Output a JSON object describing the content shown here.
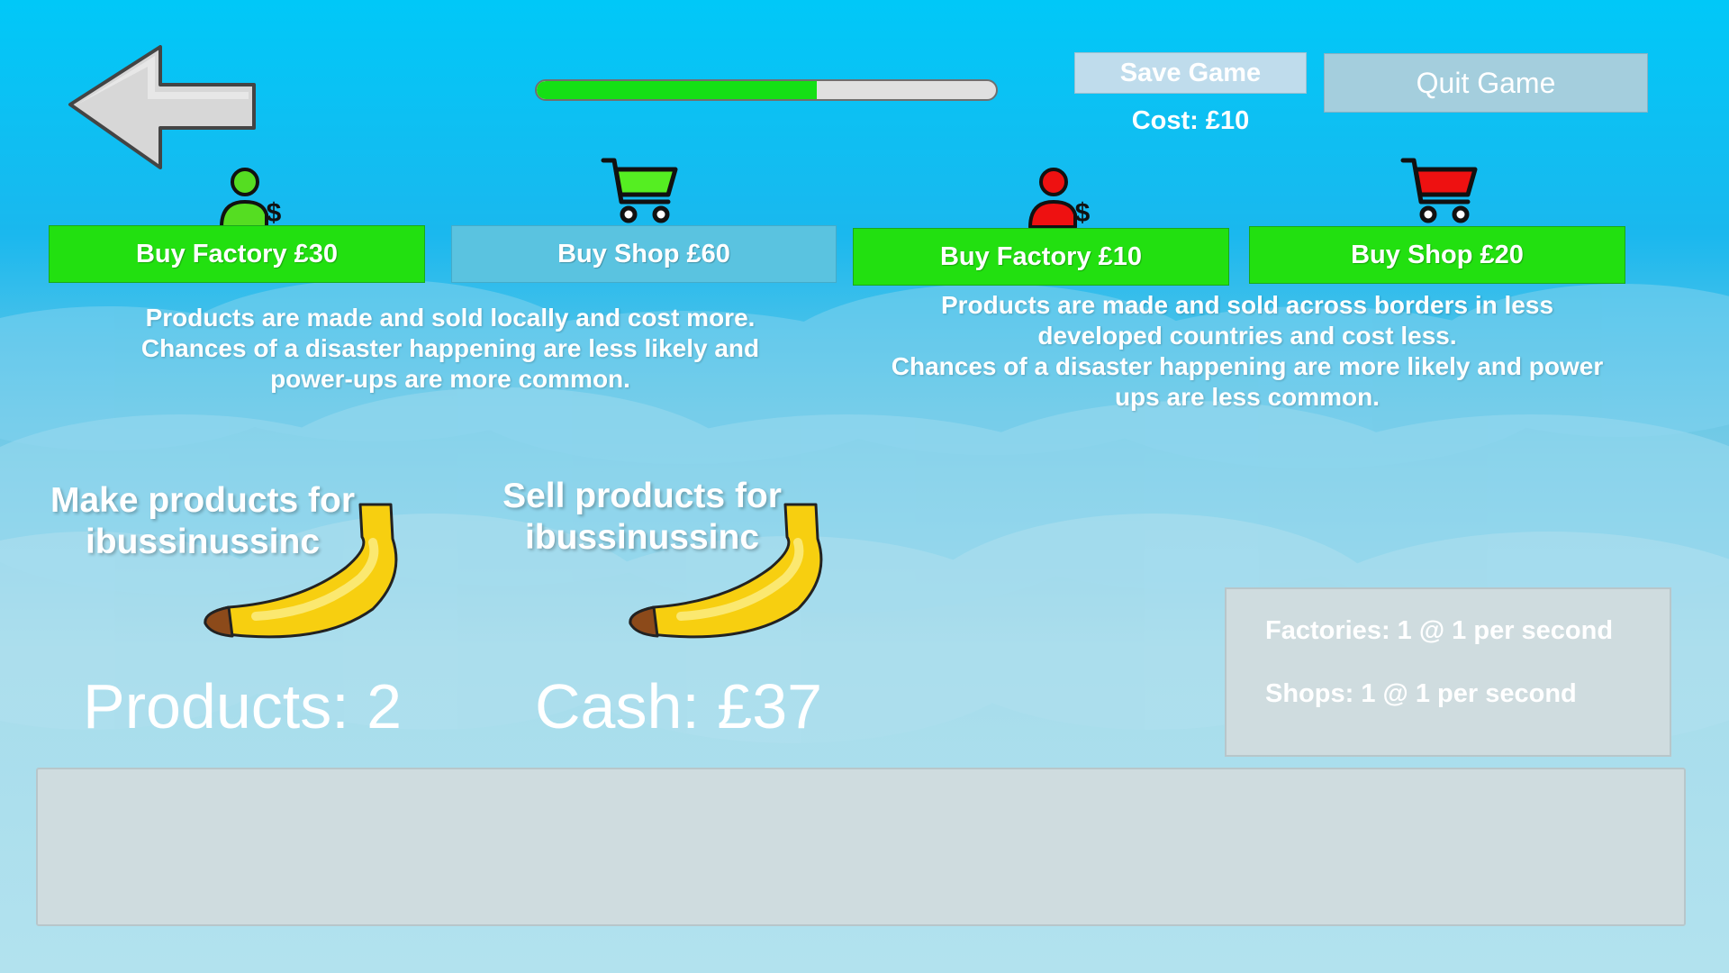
{
  "top_bar": {
    "progress": 0.61,
    "save_label": "Save Game",
    "save_cost": "Cost: £10",
    "quit_label": "Quit Game"
  },
  "local": {
    "factory_button": "Buy Factory £30",
    "shop_button": "Buy Shop £60",
    "description": [
      "Products are made and sold locally and cost more.",
      "Chances of a disaster happening are less likely and",
      "power-ups are more common."
    ]
  },
  "abroad": {
    "factory_button": "Buy Factory £10",
    "shop_button": "Buy Shop £20",
    "description": [
      "Products are made and sold across borders in less",
      "developed countries and cost less.",
      "Chances of a disaster happening are more likely and power",
      "ups are less common."
    ]
  },
  "actions": {
    "make": [
      "Make products for",
      "ibussinussinc"
    ],
    "sell": [
      "Sell products for",
      "ibussinussinc"
    ]
  },
  "stats": {
    "products": "Products: 2",
    "cash": "Cash: £37"
  },
  "info": {
    "factories": "Factories: 1 @ 1 per second",
    "shops": "Shops: 1 @ 1 per second"
  },
  "colors": {
    "buy_enabled": "#22e010",
    "buy_disabled": "#5ac3e0",
    "local_icon": "#55dd22",
    "abroad_icon": "#ee1111"
  },
  "icons": {
    "back": "left-arrow-icon",
    "factory": "person-dollar-icon",
    "shop": "shopping-cart-icon",
    "product": "banana-icon"
  }
}
